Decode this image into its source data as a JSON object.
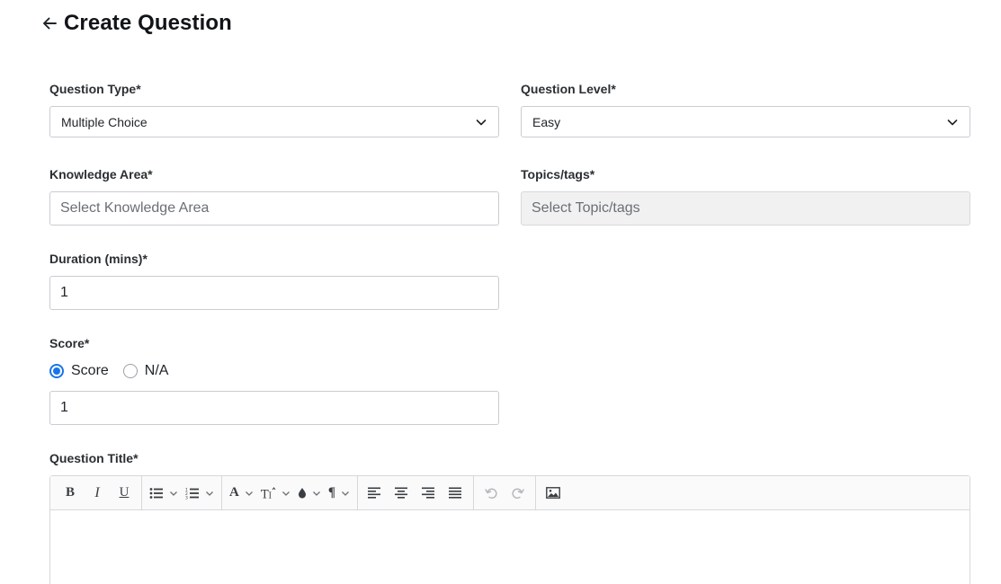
{
  "header": {
    "title": "Create Question",
    "back_icon": "arrow-left-icon"
  },
  "form": {
    "question_type": {
      "label": "Question Type*",
      "value": "Multiple Choice"
    },
    "question_level": {
      "label": "Question Level*",
      "value": "Easy"
    },
    "knowledge_area": {
      "label": "Knowledge Area*",
      "placeholder": "Select Knowledge Area"
    },
    "topics_tags": {
      "label": "Topics/tags*",
      "placeholder": "Select Topic/tags"
    },
    "duration": {
      "label": "Duration (mins)*",
      "value": "1"
    },
    "score": {
      "label": "Score*",
      "options": [
        {
          "label": "Score",
          "checked": true
        },
        {
          "label": "N/A",
          "checked": false
        }
      ],
      "value": "1"
    },
    "question_title": {
      "label": "Question Title*"
    }
  },
  "toolbar": {
    "icons": [
      "bold-icon",
      "italic-icon",
      "underline-icon",
      "bullet-list-icon",
      "numbered-list-icon",
      "font-icon",
      "font-size-icon",
      "color-drop-icon",
      "paragraph-icon",
      "align-left-icon",
      "align-center-icon",
      "align-right-icon",
      "align-justify-icon",
      "undo-icon",
      "redo-icon",
      "image-icon"
    ]
  },
  "colors": {
    "accent": "#1a73e8",
    "border": "#c9ccd1",
    "disabled_bg": "#f1f1f2"
  }
}
